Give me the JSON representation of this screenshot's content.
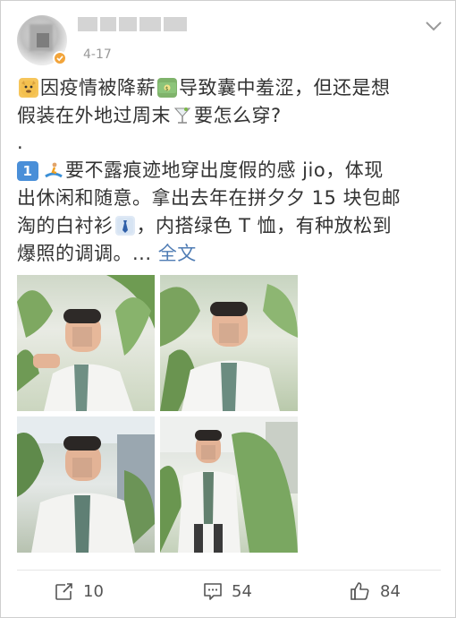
{
  "post": {
    "timestamp": "4-17",
    "text_line_1": "因疫情被降薪",
    "text_line_1b": "导致囊中羞涩，但还是想",
    "text_line_2a": "假装在外地过周末",
    "text_line_2b": "要怎么穿?",
    "dot": ".",
    "item_number": "1",
    "p2_a": "要不露痕迹地穿出度假的感 jio，体现",
    "p2_b": "出休闲和随意。拿出去年在拼夕夕 15 块包邮",
    "p2_c": "淘的白衬衫",
    "p2_c2": "，内搭绿色 T 恤，有种放松到",
    "p2_d": "爆照的调调。...",
    "full_text_link": "全文"
  },
  "icons": {
    "avatar": "avatar-blurred",
    "verified": "verified-badge-icon",
    "menu": "chevron-down-icon",
    "emoji_1": "doge-emoji-icon",
    "emoji_2": "money-emoji-icon",
    "emoji_3": "cocktail-emoji-icon",
    "emoji_4": "surfer-emoji-icon",
    "emoji_5": "necktie-emoji-icon",
    "repost": "repost-icon",
    "comment": "comment-icon",
    "like": "thumbs-up-icon"
  },
  "photos": [
    {
      "alt": "photo-1"
    },
    {
      "alt": "photo-2"
    },
    {
      "alt": "photo-3"
    },
    {
      "alt": "photo-4"
    }
  ],
  "actions": {
    "repost_count": "10",
    "comment_count": "54",
    "like_count": "84"
  },
  "colors": {
    "link": "#4f7cb4",
    "verify_badge": "#f2a43a",
    "number_badge": "#4a8fd8",
    "timestamp": "#999999"
  }
}
